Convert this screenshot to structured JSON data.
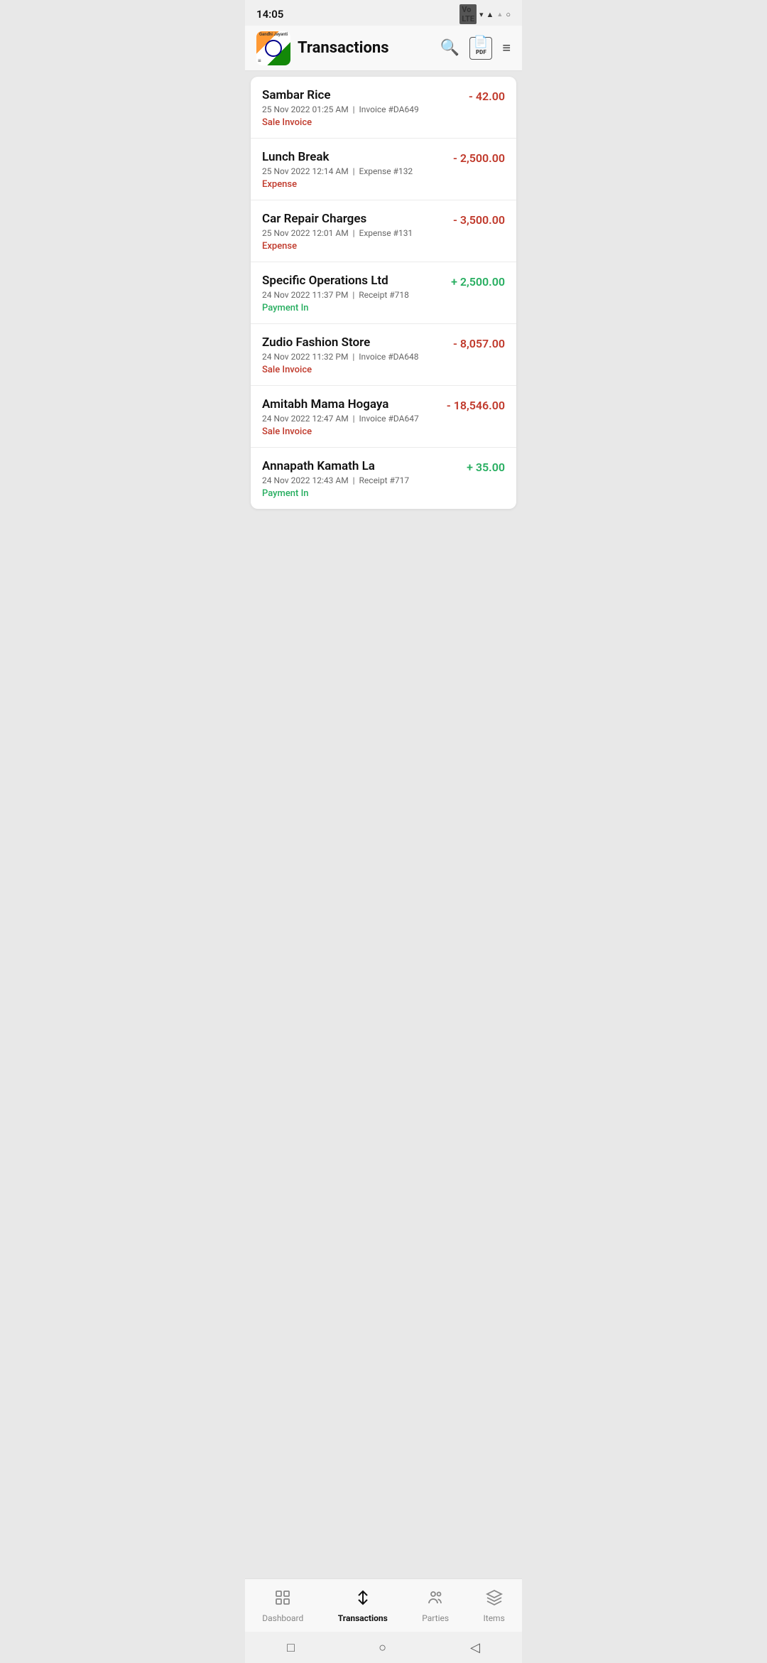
{
  "statusBar": {
    "time": "14:05",
    "volte": "VoLTE",
    "icons": [
      "wifi",
      "signal",
      "signal2",
      "battery"
    ]
  },
  "header": {
    "appName": "Gandhi Jayanti",
    "title": "Transactions",
    "searchLabel": "search",
    "pdfLabel": "PDF",
    "filterLabel": "filter"
  },
  "transactions": [
    {
      "id": 1,
      "name": "Sambar Rice",
      "date": "25 Nov 2022 01:25 AM",
      "reference": "Invoice #DA649",
      "type": "Sale Invoice",
      "typeClass": "type-sale",
      "amount": "- 42.00",
      "amountClass": "amount-negative"
    },
    {
      "id": 2,
      "name": "Lunch Break",
      "date": "25 Nov 2022 12:14 AM",
      "reference": "Expense #132",
      "type": "Expense",
      "typeClass": "type-expense",
      "amount": "- 2,500.00",
      "amountClass": "amount-negative"
    },
    {
      "id": 3,
      "name": "Car Repair Charges",
      "date": "25 Nov 2022 12:01 AM",
      "reference": "Expense #131",
      "type": "Expense",
      "typeClass": "type-expense",
      "amount": "- 3,500.00",
      "amountClass": "amount-negative"
    },
    {
      "id": 4,
      "name": "Specific Operations Ltd",
      "date": "24 Nov 2022 11:37 PM",
      "reference": "Receipt #718",
      "type": "Payment In",
      "typeClass": "type-payment-in",
      "amount": "+ 2,500.00",
      "amountClass": "amount-positive"
    },
    {
      "id": 5,
      "name": "Zudio Fashion Store",
      "date": "24 Nov 2022 11:32 PM",
      "reference": "Invoice #DA648",
      "type": "Sale Invoice",
      "typeClass": "type-sale",
      "amount": "- 8,057.00",
      "amountClass": "amount-negative"
    },
    {
      "id": 6,
      "name": "Amitabh Mama Hogaya",
      "date": "24 Nov 2022 12:47 AM",
      "reference": "Invoice #DA647",
      "type": "Sale Invoice",
      "typeClass": "type-sale",
      "amount": "- 18,546.00",
      "amountClass": "amount-negative"
    },
    {
      "id": 7,
      "name": "Annapath Kamath La",
      "date": "24 Nov 2022 12:43 AM",
      "reference": "Receipt #717",
      "type": "Payment In",
      "typeClass": "type-payment-in",
      "amount": "+ 35.00",
      "amountClass": "amount-positive"
    }
  ],
  "bottomNav": {
    "items": [
      {
        "id": "dashboard",
        "label": "Dashboard",
        "active": false
      },
      {
        "id": "transactions",
        "label": "Transactions",
        "active": true
      },
      {
        "id": "parties",
        "label": "Parties",
        "active": false
      },
      {
        "id": "items",
        "label": "Items",
        "active": false
      }
    ]
  },
  "androidNav": {
    "square": "□",
    "circle": "○",
    "back": "◁"
  }
}
